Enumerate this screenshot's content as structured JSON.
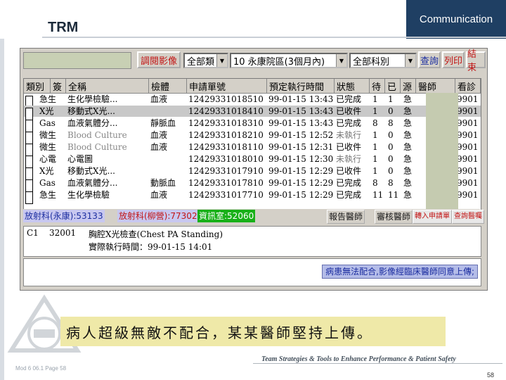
{
  "header": {
    "title": "TRM",
    "tab": "Communication"
  },
  "toolbar": {
    "view_image": "調閱影像",
    "category": "全部類",
    "range": "10 永康院區(3個月內)",
    "dept": "全部科別",
    "query": "查詢",
    "print": "列印",
    "end": "結束"
  },
  "table": {
    "columns": [
      "類別",
      "簽",
      "全稱",
      "檢體",
      "申請單號",
      "預定執行時間",
      "狀態",
      "待",
      "已",
      "源",
      "醫師",
      "看診"
    ],
    "rows": [
      {
        "type": "急生",
        "name": "生化學檢驗...",
        "specimen": "血液",
        "order": "12429331018510",
        "time": "99-01-15 13:43",
        "status": "已完成",
        "wait": "1",
        "done": "1",
        "src": "急",
        "doc": "9901"
      },
      {
        "type": "X光",
        "name": "移動式X光...",
        "specimen": "",
        "order": "12429331018410",
        "time": "99-01-15 13:43",
        "status": "已收件",
        "wait": "1",
        "done": "0",
        "src": "急",
        "doc": "9901"
      },
      {
        "type": "Gas",
        "name": "血液氣體分...",
        "specimen": "靜脈血",
        "order": "12429331018310",
        "time": "99-01-15 13:43",
        "status": "已完成",
        "wait": "8",
        "done": "8",
        "src": "急",
        "doc": "9901"
      },
      {
        "type": "微生",
        "name": "Blood Culture",
        "specimen": "血液",
        "order": "12429331018210",
        "time": "99-01-15 12:52",
        "status": "未執行",
        "wait": "1",
        "done": "0",
        "src": "急",
        "doc": "9901"
      },
      {
        "type": "微生",
        "name": "Blood Culture",
        "specimen": "血液",
        "order": "12429331018110",
        "time": "99-01-15 12:31",
        "status": "已收件",
        "wait": "1",
        "done": "0",
        "src": "急",
        "doc": "9901"
      },
      {
        "type": "心電",
        "name": "心電圖",
        "specimen": "",
        "order": "12429331018010",
        "time": "99-01-15 12:30",
        "status": "未執行",
        "wait": "1",
        "done": "0",
        "src": "急",
        "doc": "9901"
      },
      {
        "type": "X光",
        "name": "移動式X光...",
        "specimen": "",
        "order": "12429331017910",
        "time": "99-01-15 12:29",
        "status": "已收件",
        "wait": "1",
        "done": "0",
        "src": "急",
        "doc": "9901"
      },
      {
        "type": "Gas",
        "name": "血液氣體分...",
        "specimen": "動脈血",
        "order": "12429331017810",
        "time": "99-01-15 12:29",
        "status": "已完成",
        "wait": "8",
        "done": "8",
        "src": "急",
        "doc": "9901"
      },
      {
        "type": "急生",
        "name": "生化學檢驗",
        "specimen": "血液",
        "order": "12429331017710",
        "time": "99-01-15 12:29",
        "status": "已完成",
        "wait": "11",
        "done": "11",
        "src": "急",
        "doc": "9901"
      }
    ]
  },
  "statusbar": {
    "radiology": "放射科(永康):53133",
    "radiology_tube": "放射科(柳營):77302",
    "info": "資訊室:52060",
    "report_doc": "報告醫師",
    "review_doc": "審核醫師",
    "upload": "轉入申請單",
    "query_report": "查詢醫囑"
  },
  "detail": {
    "code": "C1",
    "num": "32001",
    "exam": "胸腔X光檢查(Chest PA Standing)",
    "actual": "實際執行時間：99-01-15 14:01"
  },
  "warning": "病患無法配合,影像經臨床醫師同意上傳;",
  "caption": "病人超級無敵不配合，某某醫師堅持上傳。",
  "footer": {
    "module": "Mod 6 06.1  Page 58",
    "tagline": "Team Strategies & Tools to Enhance Performance & Patient Safety",
    "page": "58"
  }
}
